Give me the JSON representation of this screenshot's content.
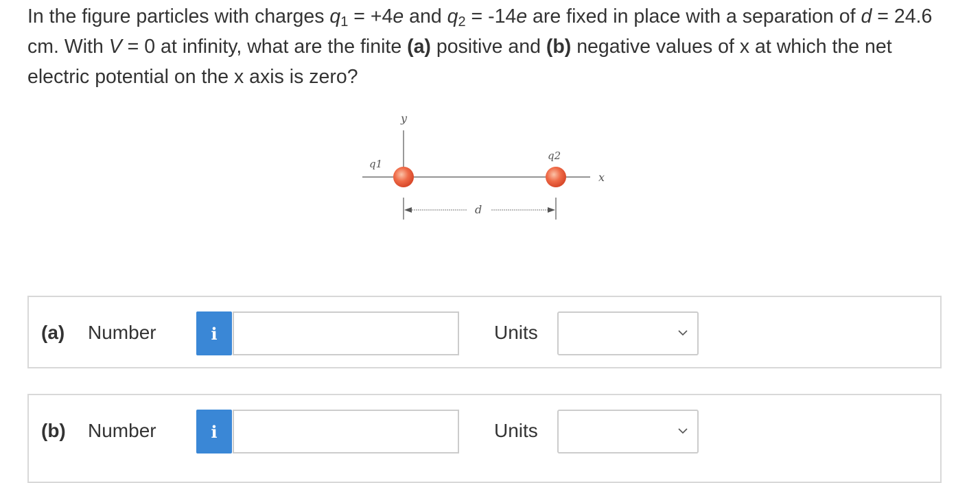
{
  "question": {
    "t1": "In the figure particles with charges ",
    "q1_sym": "q",
    "q1_sub": "1",
    "t2": " = +4",
    "e1": "e",
    "t3": " and ",
    "q2_sym": "q",
    "q2_sub": "2",
    "t4": " = -14",
    "e2": "e",
    "t5": " are fixed in place with a separation of ",
    "d_sym": "d",
    "t6": " = 24.6 cm. With ",
    "v_sym": "V",
    "t7": " = 0 at infinity, what are the finite ",
    "a_bold": "(a)",
    "t8": " positive and ",
    "b_bold": "(b)",
    "t9": " negative values of x at which the net electric potential on the x axis is zero?"
  },
  "figure": {
    "y_label": "y",
    "x_label": "x",
    "q1_label": "q1",
    "q2_label": "q2",
    "d_label": "d",
    "charge_color": "#e8563a"
  },
  "answers": [
    {
      "part": "(a)",
      "number_label": "Number",
      "info_icon_text": "i",
      "value": "",
      "units_label": "Units",
      "units_value": ""
    },
    {
      "part": "(b)",
      "number_label": "Number",
      "info_icon_text": "i",
      "value": "",
      "units_label": "Units",
      "units_value": ""
    }
  ],
  "colors": {
    "info_button": "#3a87d6",
    "box_border": "#d8d8d8"
  }
}
